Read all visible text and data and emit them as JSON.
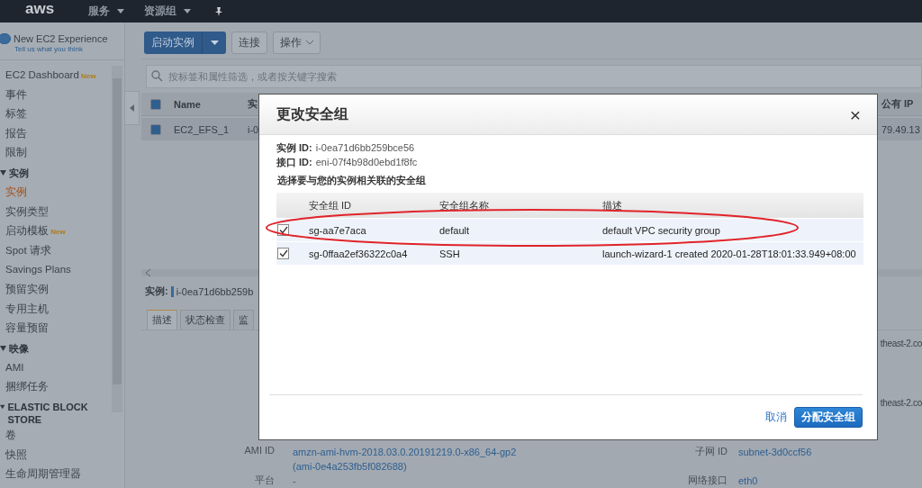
{
  "nav": {
    "logo": "aws",
    "menus": [
      {
        "label": "服务"
      },
      {
        "label": "资源组"
      }
    ]
  },
  "sidebar": {
    "experience_toggle": {
      "label": "New EC2 Experience",
      "on": true
    },
    "feedback_link": "Tell us what you think",
    "sections": [
      {
        "items": [
          {
            "label": "EC2 Dashboard",
            "badge": "New",
            "selected": false
          },
          {
            "label": "事件",
            "selected": false
          },
          {
            "label": "标签",
            "selected": false
          },
          {
            "label": "报告",
            "selected": false
          },
          {
            "label": "限制",
            "selected": false
          }
        ]
      },
      {
        "title": "实例",
        "expanded": true,
        "items": [
          {
            "label": "实例",
            "selected": true
          },
          {
            "label": "实例类型",
            "selected": false
          },
          {
            "label": "启动模板",
            "badge": "New",
            "selected": false
          },
          {
            "label": "Spot 请求",
            "selected": false
          },
          {
            "label": "Savings Plans",
            "selected": false
          },
          {
            "label": "预留实例",
            "selected": false
          },
          {
            "label": "专用主机",
            "selected": false
          },
          {
            "label": "容量预留",
            "selected": false
          }
        ]
      },
      {
        "title": "映像",
        "expanded": true,
        "items": [
          {
            "label": "AMI",
            "selected": false
          },
          {
            "label": "捆绑任务",
            "selected": false
          }
        ]
      },
      {
        "title": "ELASTIC BLOCK STORE",
        "expanded": true,
        "items": [
          {
            "label": "卷",
            "selected": false
          },
          {
            "label": "快照",
            "selected": false
          },
          {
            "label": "生命周期管理器",
            "selected": false
          }
        ]
      }
    ]
  },
  "toolbar": {
    "launch": "启动实例",
    "connect": "连接",
    "actions": "操作"
  },
  "search": {
    "placeholder": "按标签和属性筛选，或者按关键字搜索"
  },
  "instances": {
    "all_selected": true,
    "columns": [
      "Name",
      "实",
      "公有 IP"
    ],
    "rows": [
      {
        "selected": true,
        "cells": [
          "EC2_EFS_1",
          "i-0",
          "79.49.13"
        ]
      }
    ]
  },
  "details": {
    "label": "实例:",
    "instance_id": "i-0ea71d6bb259b",
    "tabs": [
      {
        "label": "描述",
        "selected": true
      },
      {
        "label": "状态检查",
        "selected": false
      },
      {
        "label": "监",
        "selected": false
      }
    ],
    "rows": [
      {
        "right_value": "theast-2.co"
      },
      {
        "right_value": "theast-2.co"
      },
      {
        "left_label": "AMI ID",
        "left_value": [
          "amzn-ami-hvm-2018.03.0.20191219.0-x86_64-gp2",
          "(ami-0e4a253fb5f082688)"
        ],
        "right_label": "子网 ID",
        "right_value": "subnet-3d0ccf56"
      },
      {
        "left_label": "平台",
        "left_value": [
          "-"
        ],
        "right_label": "网络接口",
        "right_value": "eth0"
      }
    ]
  },
  "dialog": {
    "title": "更改安全组",
    "close": "×",
    "info": [
      {
        "label": "实例 ID:",
        "value": "i-0ea71d6bb259bce56"
      },
      {
        "label": "接口 ID:",
        "value": "eni-07f4b98d0ebd1f8fc"
      }
    ],
    "prompt": "选择要与您的实例相关联的安全组",
    "columns": [
      "安全组 ID",
      "安全组名称",
      "描述"
    ],
    "rows": [
      {
        "checked": true,
        "cells": [
          "sg-aa7e7aca",
          "default",
          "default VPC security group"
        ]
      },
      {
        "checked": true,
        "cells": [
          "sg-0ffaa2ef36322c0a4",
          "SSH",
          "launch-wizard-1 created 2020-01-28T18:01:33.949+08:00"
        ]
      }
    ],
    "cancel": "取消",
    "submit": "分配安全组"
  }
}
